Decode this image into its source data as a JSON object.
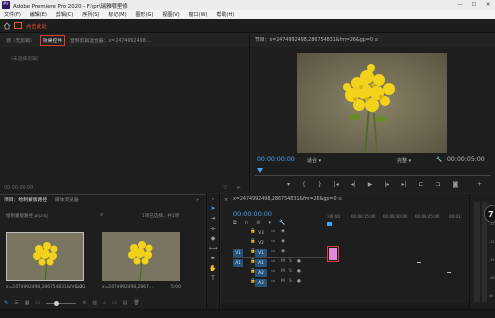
{
  "window": {
    "title": "Adobe Premiere Pro 2020 - F:\\pr\\瑞雅哪里修",
    "minimize": "—",
    "maximize": "☐",
    "close": "✕"
  },
  "menu": [
    "文件(F)",
    "编辑(E)",
    "剪辑(C)",
    "序列(S)",
    "标记(M)",
    "图形(G)",
    "视图(V)",
    "窗口(W)",
    "帮助(H)"
  ],
  "workspace": {
    "hint": "点击此处"
  },
  "source_panel": {
    "tabs": [
      "源（无剪辑）",
      "效果控件",
      "音频剪辑混合器：x=2474992498..."
    ],
    "no_clip": "（未选择剪辑）",
    "timecode": "00:00:00:00"
  },
  "program_panel": {
    "tab": "节目：x=2474992498,286754831&fm=26&gp=0 ≡",
    "timecode": "00:00:00:00",
    "fit": "适合",
    "quality": "完整",
    "duration": "00:00:05:00"
  },
  "project_panel": {
    "tab_active": "项目：绘制蒙版路径",
    "tab_other": "媒体浏览器",
    "more": "»",
    "project_file": "绘制蒙版路径.prproj",
    "selection_info": "1项已选择，共1项",
    "items": [
      {
        "name": "x=2474992498,286754831&fm=2...",
        "duration": "5:00"
      },
      {
        "name": "x=2474992498,2867...",
        "duration": "5:00"
      }
    ]
  },
  "timeline": {
    "tab": "x=2474992498,286754831&fm=26&gp=0 ≡",
    "close": "×",
    "timecode": "00:00:00:00",
    "ruler": [
      ":00:00",
      "00:00:15:00",
      "00:00:30:00",
      "00:00:45:00",
      "00:01:"
    ],
    "tracks": [
      {
        "label": "V3",
        "target": ""
      },
      {
        "label": "V2",
        "target": ""
      },
      {
        "label": "V1",
        "target": "V1"
      },
      {
        "label": "A1",
        "target": "A1"
      },
      {
        "label": "A2",
        "target": ""
      },
      {
        "label": "A3",
        "target": ""
      }
    ],
    "track_icons": {
      "lock": "🔒",
      "sync": "▭",
      "eye": "👁",
      "mute": "M",
      "solo": "S",
      "mic": "🎤"
    }
  },
  "meter": {
    "levels": [
      "0",
      "-12",
      "-24",
      "-36",
      "-48",
      "dB"
    ]
  },
  "badge": "7",
  "colors": {
    "accent": "#4aa3f2",
    "highlight_box": "#e53935",
    "clip_pink": "#e286d9",
    "target_blue": "#26547a"
  }
}
